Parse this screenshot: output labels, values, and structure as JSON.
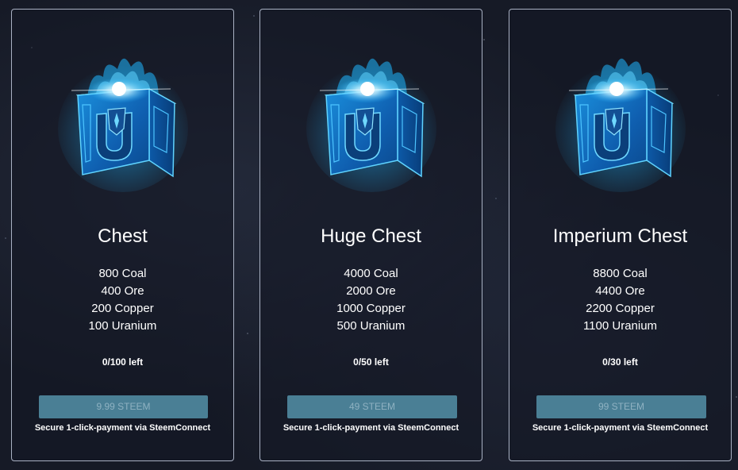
{
  "cards": [
    {
      "title": "Chest",
      "contents": [
        "800 Coal",
        "400 Ore",
        "200 Copper",
        "100 Uranium"
      ],
      "stock": "0/100 left",
      "price_label": "9.99 STEEM",
      "payment_note": "Secure 1-click-payment via SteemConnect",
      "icon": "chest-icon"
    },
    {
      "title": "Huge Chest",
      "contents": [
        "4000 Coal",
        "2000 Ore",
        "1000 Copper",
        "500 Uranium"
      ],
      "stock": "0/50 left",
      "price_label": "49 STEEM",
      "payment_note": "Secure 1-click-payment via SteemConnect",
      "icon": "huge-chest-icon"
    },
    {
      "title": "Imperium Chest",
      "contents": [
        "8800 Coal",
        "4400 Ore",
        "2200 Copper",
        "1100 Uranium"
      ],
      "stock": "0/30 left",
      "price_label": "99 STEEM",
      "payment_note": "Secure 1-click-payment via SteemConnect",
      "icon": "imperium-chest-icon"
    }
  ],
  "colors": {
    "background": "#161a26",
    "card_border": "#a9b1c3",
    "button_bg": "#4a7f95",
    "button_text": "#8fb2c2",
    "chest_glow": "#1fb6ff"
  }
}
